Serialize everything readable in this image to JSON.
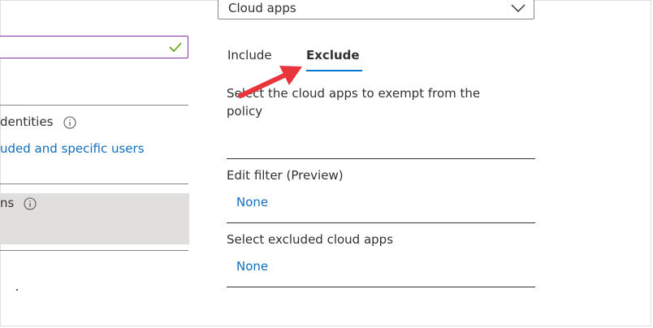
{
  "left_panel": {
    "identities_label": "dentities",
    "users_link": "uded and specific users",
    "conditions_label": "ns"
  },
  "right_panel": {
    "dropdown": {
      "selected": "Cloud apps"
    },
    "tabs": [
      {
        "label": "Include",
        "active": false
      },
      {
        "label": "Exclude",
        "active": true
      }
    ],
    "description": [
      "Select the cloud apps to exempt from the",
      "policy"
    ],
    "edit_filter": {
      "label": "Edit filter (Preview)",
      "value": "None"
    },
    "excluded_apps": {
      "label": "Select excluded cloud apps",
      "value": "None"
    }
  },
  "colors": {
    "accent": "#0078d4",
    "link": "#106ebe",
    "input_border": "#8a2da5",
    "check": "#57a300",
    "annotation_arrow": "#e8353b"
  },
  "icons": [
    "check-icon",
    "info-icon",
    "chevron-down-icon",
    "annotation-arrow"
  ]
}
